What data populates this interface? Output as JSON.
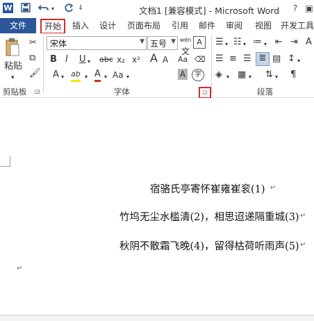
{
  "window": {
    "title": "文档1 [兼容模式] - Microsoft Word",
    "app_icon": "W"
  },
  "quick_access": {
    "save_icon": "save-icon",
    "undo_icon": "undo-icon",
    "redo_icon": "redo-icon"
  },
  "tabs": {
    "file": "文件",
    "home": "开始",
    "insert": "插入",
    "design": "设计",
    "layout": "页面布局",
    "references": "引用",
    "mailings": "邮件",
    "review": "审阅",
    "view": "视图",
    "developer": "开发工具"
  },
  "ribbon": {
    "clipboard": {
      "paste": "粘贴",
      "group_label": "剪贴板"
    },
    "font": {
      "font_name": "宋体",
      "font_size": "五号",
      "group_label": "字体",
      "wen_label": "wén",
      "wen_char": "文",
      "char_a": "A",
      "bold": "B",
      "italic": "I",
      "underline": "U",
      "strike": "abc",
      "subscript": "x₂",
      "superscript": "x²",
      "highlight": "ab",
      "font_color": "A",
      "char_size": "Aa",
      "char_shading": "A",
      "enclose": "字",
      "grow": "A",
      "shrink": "A"
    },
    "paragraph": {
      "group_label": "段落"
    }
  },
  "document": {
    "title_line": "宿骆氏亭寄怀崔雍崔衮(1)",
    "line2": "竹坞无尘水槛清(2)，相思迢递隔重城(3)",
    "line3": "秋阴不散霜飞晚(4)，留得枯荷听雨声(5)",
    "paragraph_mark": "↵"
  },
  "colors": {
    "file_tab_bg": "#2b579a",
    "highlight_box": "#d42a2a"
  }
}
